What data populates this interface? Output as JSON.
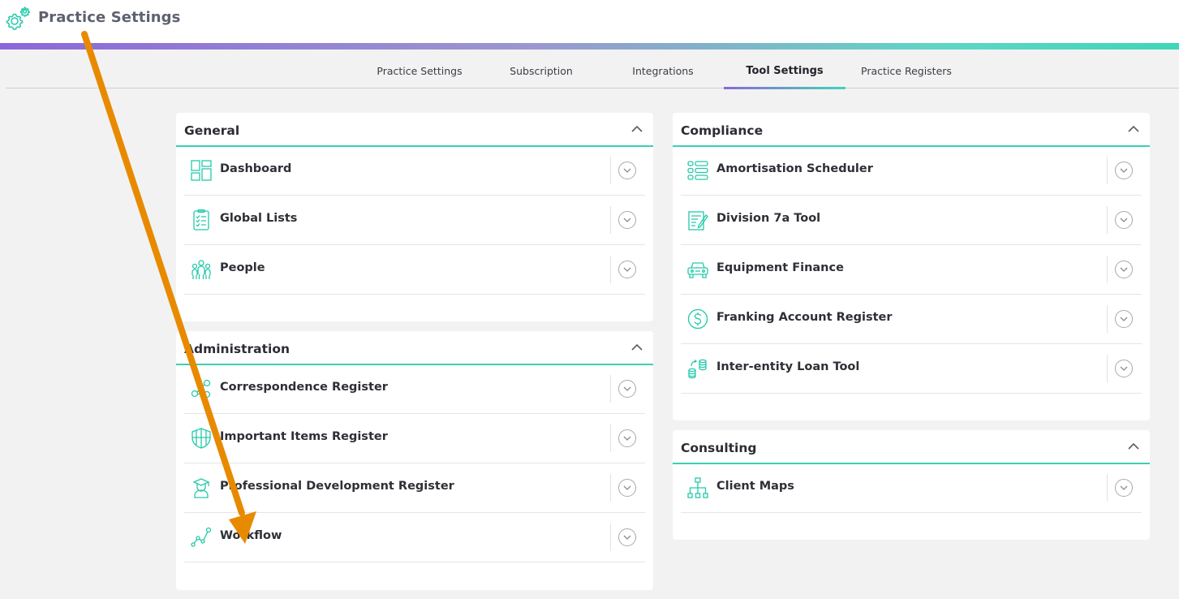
{
  "header": {
    "title": "Practice Settings",
    "icon": "gear-icon"
  },
  "tabs": [
    {
      "label": "Practice Settings"
    },
    {
      "label": "Subscription"
    },
    {
      "label": "Integrations"
    },
    {
      "label": "Tool Settings",
      "active": true
    },
    {
      "label": "Practice Registers"
    }
  ],
  "sections": {
    "general": {
      "title": "General",
      "items": [
        {
          "label": "Dashboard",
          "icon": "dashboard-icon"
        },
        {
          "label": "Global Lists",
          "icon": "checklist-icon"
        },
        {
          "label": "People",
          "icon": "people-icon"
        }
      ]
    },
    "administration": {
      "title": "Administration",
      "items": [
        {
          "label": "Correspondence Register",
          "icon": "share-icon"
        },
        {
          "label": "Important Items Register",
          "icon": "shield-icon"
        },
        {
          "label": "Professional Development Register",
          "icon": "graduate-icon"
        },
        {
          "label": "Workflow",
          "icon": "workflow-icon"
        }
      ]
    },
    "compliance": {
      "title": "Compliance",
      "items": [
        {
          "label": "Amortisation Scheduler",
          "icon": "list-icon"
        },
        {
          "label": "Division 7a Tool",
          "icon": "form-edit-icon"
        },
        {
          "label": "Equipment Finance",
          "icon": "car-icon"
        },
        {
          "label": "Franking Account Register",
          "icon": "dollar-icon"
        },
        {
          "label": "Inter-entity Loan Tool",
          "icon": "coins-icon"
        }
      ]
    },
    "consulting": {
      "title": "Consulting",
      "items": [
        {
          "label": "Client Maps",
          "icon": "hierarchy-icon"
        }
      ]
    }
  },
  "colors": {
    "accent_teal": "#3bd0b5",
    "accent_purple": "#8b68d9",
    "annotation_arrow": "#e88a00"
  }
}
